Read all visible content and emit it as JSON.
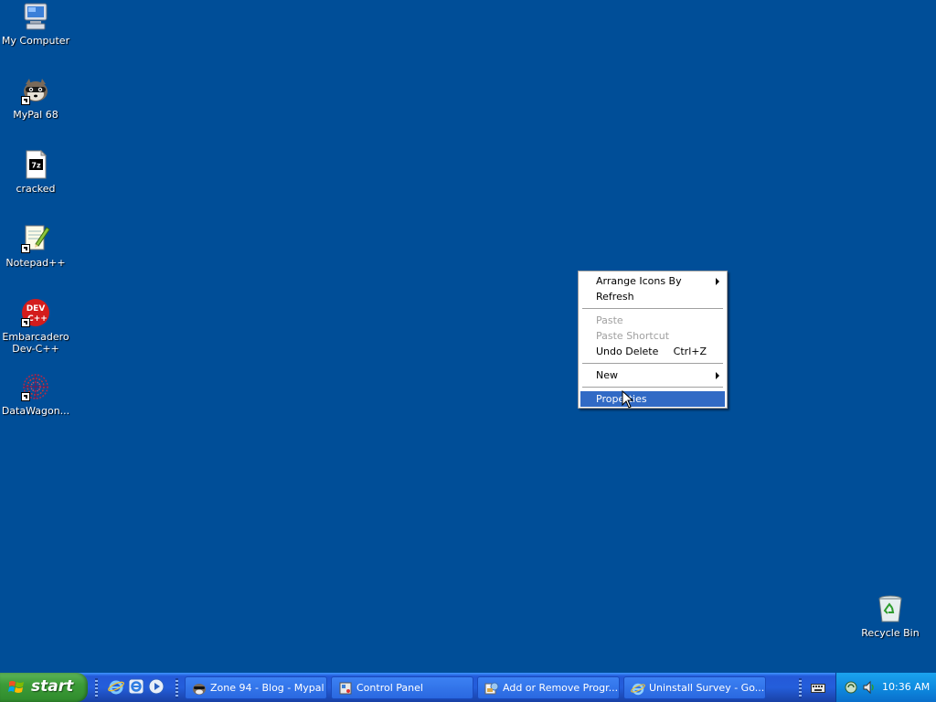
{
  "desktop_icons": [
    {
      "label": "My Computer",
      "icon": "my-computer-icon"
    },
    {
      "label": "MyPal 68",
      "icon": "raccoon-browser-icon"
    },
    {
      "label": "cracked",
      "icon": "7z-archive-icon"
    },
    {
      "label": "Notepad++",
      "icon": "notepad-plus-plus-icon"
    },
    {
      "label": "Embarcadero Dev-C++",
      "icon": "dev-cpp-icon"
    },
    {
      "label": "DataWagon...",
      "icon": "datawagon-icon"
    },
    {
      "label": "Recycle Bin",
      "icon": "recycle-bin-icon"
    }
  ],
  "context_menu": {
    "items": [
      {
        "label": "Arrange Icons By",
        "submenu": true
      },
      {
        "label": "Refresh"
      },
      {
        "label": "Paste",
        "disabled": true
      },
      {
        "label": "Paste Shortcut",
        "disabled": true
      },
      {
        "label": "Undo Delete",
        "accel": "Ctrl+Z"
      },
      {
        "label": "New",
        "submenu": true
      },
      {
        "label": "Properties",
        "selected": true
      }
    ]
  },
  "taskbar": {
    "start_label": "start",
    "quick_launch": [
      "internet-explorer-icon",
      "ie-alt-icon",
      "media-player-icon"
    ],
    "tasks": [
      {
        "label": "Zone 94 - Blog - Mypal",
        "icon": "mypal-icon"
      },
      {
        "label": "Control Panel",
        "icon": "control-panel-icon"
      },
      {
        "label": "Add or Remove Progr...",
        "icon": "add-remove-programs-icon"
      },
      {
        "label": "Uninstall Survey - Go...",
        "icon": "internet-explorer-icon"
      }
    ],
    "tray": {
      "clock": "10:36 AM",
      "icons": [
        "keyboard-icon",
        "network-icon",
        "speaker-icon"
      ]
    }
  },
  "colors": {
    "desktop": "#004e98",
    "menu_highlight": "#316ac5",
    "start_green": "#3c9c38",
    "taskbar_blue": "#245edb"
  }
}
